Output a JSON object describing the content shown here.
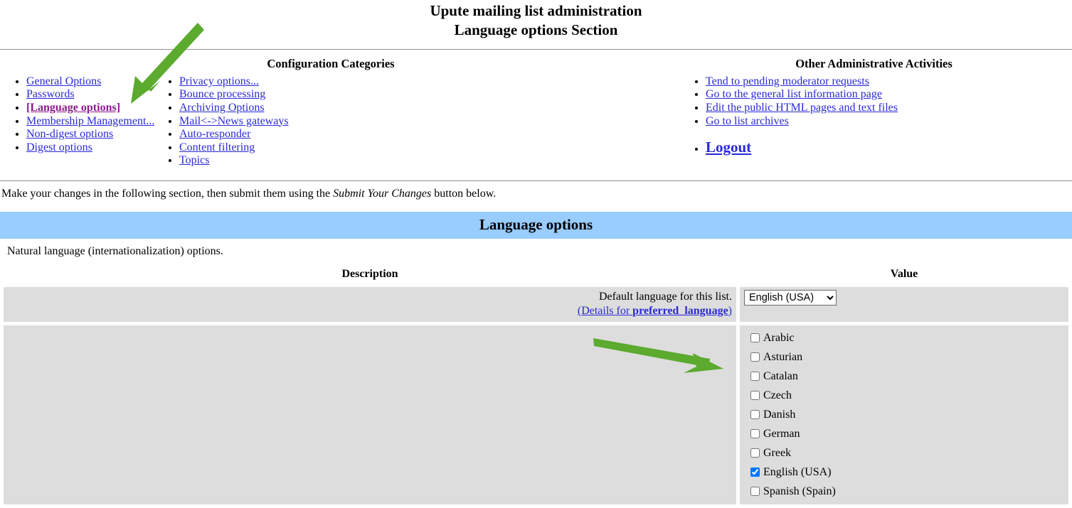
{
  "header": {
    "title_line1": "Upute mailing list administration",
    "title_line2": "Language options Section"
  },
  "nav": {
    "config_title": "Configuration Categories",
    "config_col1": [
      {
        "label": "General Options",
        "current": false
      },
      {
        "label": "Passwords",
        "current": false
      },
      {
        "label": "[Language options]",
        "current": true
      },
      {
        "label": "Membership Management...",
        "current": false
      },
      {
        "label": "Non-digest options",
        "current": false
      },
      {
        "label": "Digest options",
        "current": false
      }
    ],
    "config_col2": [
      {
        "label": "Privacy options...",
        "current": false
      },
      {
        "label": "Bounce processing",
        "current": false
      },
      {
        "label": "Archiving Options",
        "current": false
      },
      {
        "label": "Mail<->News gateways",
        "current": false
      },
      {
        "label": "Auto-responder",
        "current": false
      },
      {
        "label": "Content filtering",
        "current": false
      },
      {
        "label": "Topics",
        "current": false
      }
    ],
    "admin_title": "Other Administrative Activities",
    "admin_links": [
      "Tend to pending moderator requests",
      "Go to the general list information page",
      "Edit the public HTML pages and text files",
      "Go to list archives"
    ],
    "logout_label": "Logout"
  },
  "instruction": {
    "before": "Make your changes in the following section, then submit them using the ",
    "emphasis": "Submit Your Changes",
    "after": " button below."
  },
  "section": {
    "banner_title": "Language options",
    "description": "Natural language (internationalization) options."
  },
  "table": {
    "col_description": "Description",
    "col_value": "Value",
    "rows": [
      {
        "desc_line1": "Default language for this list.",
        "detail_prefix": "(Details for ",
        "detail_bold": "preferred_language",
        "detail_suffix": ")",
        "select_value": "English (USA)",
        "select_options": [
          "Arabic",
          "Asturian",
          "Catalan",
          "Czech",
          "Danish",
          "German",
          "Greek",
          "English (USA)",
          "Spanish (Spain)"
        ]
      }
    ],
    "available_languages": [
      {
        "label": "Arabic",
        "checked": false
      },
      {
        "label": "Asturian",
        "checked": false
      },
      {
        "label": "Catalan",
        "checked": false
      },
      {
        "label": "Czech",
        "checked": false
      },
      {
        "label": "Danish",
        "checked": false
      },
      {
        "label": "German",
        "checked": false
      },
      {
        "label": "Greek",
        "checked": false
      },
      {
        "label": "English (USA)",
        "checked": true
      },
      {
        "label": "Spanish (Spain)",
        "checked": false
      }
    ]
  },
  "annotations": [
    {
      "name": "arrow-language-nav",
      "color": "#5CAA2E",
      "points_to": "[Language options]"
    },
    {
      "name": "arrow-language-list",
      "color": "#5CAA2E",
      "points_to": "available languages checkbox list"
    }
  ],
  "colors": {
    "link": "#2a29d6",
    "current_link": "#8b1a8b",
    "banner_bg": "#99ccff",
    "cell_bg": "#dddddd",
    "annotation_green": "#5CAA2E"
  }
}
